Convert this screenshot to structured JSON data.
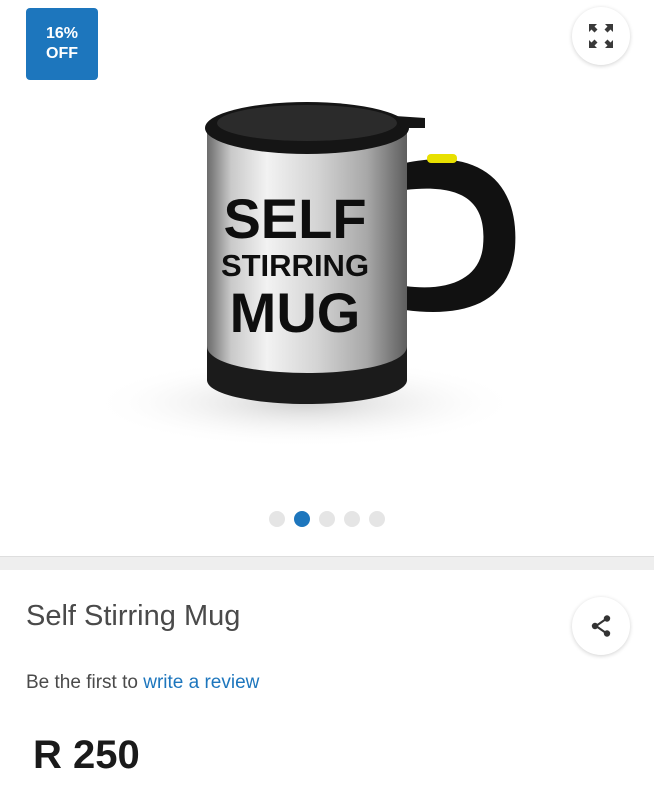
{
  "gallery": {
    "badge": {
      "percent": "16%",
      "label": "OFF"
    },
    "expand_icon": "expand-arrows-icon",
    "image": {
      "name": "self-stirring-mug-photo",
      "mug_text": [
        "SELF",
        "STIRRING",
        "MUG"
      ]
    },
    "dots": {
      "total": 5,
      "active_index": 1
    }
  },
  "product": {
    "title": "Self Stirring Mug",
    "share_icon": "share-icon",
    "review_prefix": "Be the first to",
    "review_link": "write a review",
    "price": "R 250"
  },
  "colors": {
    "accent": "#1d76bd",
    "badge_bg": "#1d76bd",
    "text": "#4a4a4a",
    "price": "#1a1a1a"
  }
}
